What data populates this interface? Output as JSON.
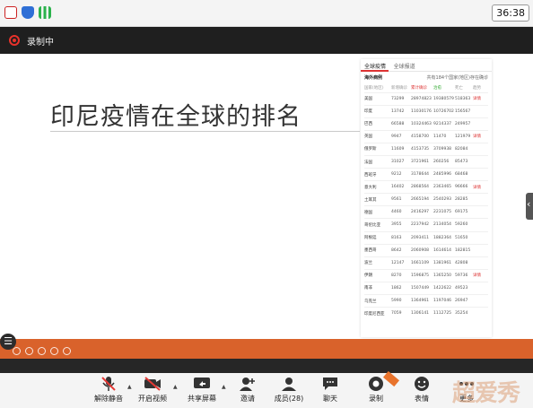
{
  "status_bar": {
    "time": "36:38"
  },
  "recording": {
    "label": "录制中",
    "accent": "#e8322b"
  },
  "slide": {
    "title": "印尼疫情在全球的排名",
    "panel": {
      "tabs": [
        "全球疫情",
        "全球报道"
      ],
      "section": "海外病例",
      "summary": "共有184个国家(地区)存在确诊",
      "headers": [
        "国家(地区)",
        "新增确诊",
        "累计确诊",
        "治愈",
        "死亡",
        "趋势"
      ],
      "rows": [
        [
          "美国",
          "73299",
          "28974823",
          "19380579",
          "518363",
          "详情"
        ],
        [
          "印度",
          "13742",
          "11030176",
          "10726702",
          "156567",
          ""
        ],
        [
          "巴西",
          "66588",
          "10324463",
          "9214337",
          "249957",
          ""
        ],
        [
          "英国",
          "9947",
          "4158700",
          "11470",
          "121979",
          "详情"
        ],
        [
          "俄罗斯",
          "11609",
          "4153735",
          "3709938",
          "82084",
          ""
        ],
        [
          "法国",
          "31027",
          "3721961",
          "260256",
          "85473",
          ""
        ],
        [
          "西班牙",
          "9212",
          "3178644",
          "2485996",
          "68468",
          ""
        ],
        [
          "意大利",
          "16402",
          "2868564",
          "2363465",
          "96666",
          "详情"
        ],
        [
          "土耳其",
          "9561",
          "2665194",
          "2540293",
          "28285",
          ""
        ],
        [
          "德国",
          "4460",
          "2416297",
          "2231075",
          "69175",
          ""
        ],
        [
          "哥伦比亚",
          "3955",
          "2237942",
          "2134054",
          "59260",
          ""
        ],
        [
          "阿根廷",
          "8163",
          "2093411",
          "1882364",
          "51650",
          ""
        ],
        [
          "墨西哥",
          "8642",
          "2060908",
          "1614614",
          "182815",
          ""
        ],
        [
          "波兰",
          "12147",
          "1661109",
          "1381961",
          "42808",
          ""
        ],
        [
          "伊朗",
          "8270",
          "1596875",
          "1365250",
          "59736",
          "详情"
        ],
        [
          "南非",
          "1862",
          "1507449",
          "1422622",
          "49523",
          ""
        ],
        [
          "乌克兰",
          "5990",
          "1364961",
          "1197046",
          "26947",
          ""
        ],
        [
          "印度尼西亚",
          "7059",
          "1306141",
          "1112725",
          "35254",
          ""
        ]
      ]
    }
  },
  "toolbar": {
    "items": [
      {
        "label": "解除静音",
        "icon": "microphone-muted-icon"
      },
      {
        "label": "开启视频",
        "icon": "video-camera-icon"
      },
      {
        "label": "共享屏幕",
        "icon": "screen-share-icon"
      },
      {
        "label": "邀请",
        "icon": "invite-user-icon"
      },
      {
        "label": "成员(28)",
        "icon": "members-icon"
      },
      {
        "label": "聊天",
        "icon": "chat-icon"
      },
      {
        "label": "录制",
        "icon": "record-icon"
      },
      {
        "label": "表情",
        "icon": "emoji-icon"
      },
      {
        "label": "更多",
        "icon": "more-icon"
      }
    ]
  },
  "watermark": {
    "text": "超爱秀"
  }
}
